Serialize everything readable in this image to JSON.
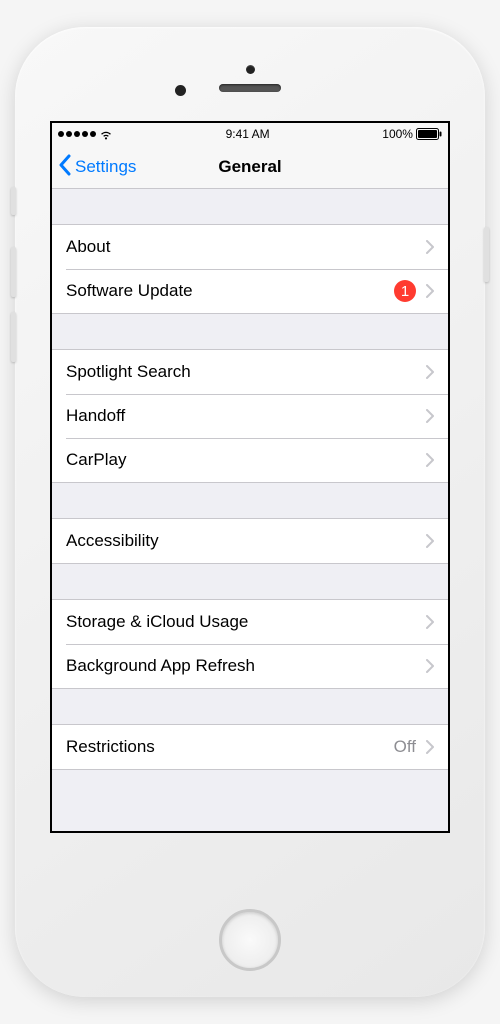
{
  "statusBar": {
    "time": "9:41 AM",
    "battery": "100%"
  },
  "nav": {
    "backLabel": "Settings",
    "title": "General"
  },
  "groups": [
    {
      "rows": [
        {
          "id": "about",
          "label": "About"
        },
        {
          "id": "software-update",
          "label": "Software Update",
          "badge": "1"
        }
      ]
    },
    {
      "rows": [
        {
          "id": "spotlight-search",
          "label": "Spotlight Search"
        },
        {
          "id": "handoff",
          "label": "Handoff"
        },
        {
          "id": "carplay",
          "label": "CarPlay"
        }
      ]
    },
    {
      "rows": [
        {
          "id": "accessibility",
          "label": "Accessibility"
        }
      ]
    },
    {
      "rows": [
        {
          "id": "storage-icloud",
          "label": "Storage & iCloud Usage"
        },
        {
          "id": "background-app-refresh",
          "label": "Background App Refresh"
        }
      ]
    },
    {
      "rows": [
        {
          "id": "restrictions",
          "label": "Restrictions",
          "value": "Off"
        }
      ]
    }
  ]
}
